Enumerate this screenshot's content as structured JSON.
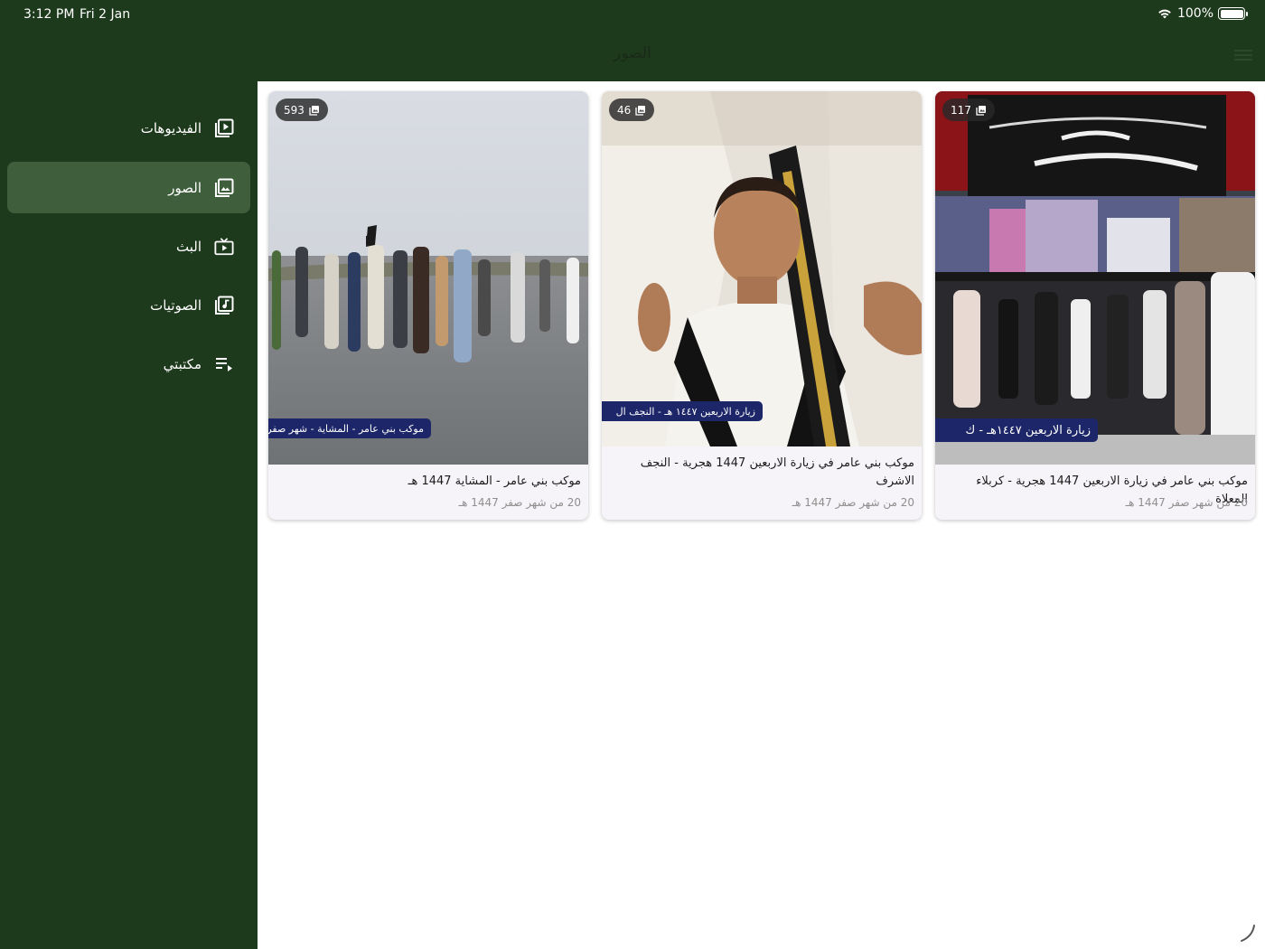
{
  "status_bar": {
    "time": "3:12 PM",
    "date": "Fri 2 Jan",
    "battery": "100%"
  },
  "nav": {
    "title": "الصور"
  },
  "sidebar": {
    "items": [
      {
        "label": "الفيديوهات",
        "icon": "video-library-icon",
        "active": false
      },
      {
        "label": "الصور",
        "icon": "photo-library-icon",
        "active": true
      },
      {
        "label": "البث",
        "icon": "live-tv-icon",
        "active": false
      },
      {
        "label": "الصوتيات",
        "icon": "audio-library-icon",
        "active": false
      },
      {
        "label": "مكتبتي",
        "icon": "playlist-icon",
        "active": false
      }
    ]
  },
  "albums": [
    {
      "count": "117",
      "banner_text": "زيارة الاربعين ١٤٤٧هـ - ك",
      "title": "موكب بني عامر في زيارة الاربعين 1447 هجرية - كربلاء المعلاة",
      "date": "20 من شهر صفر 1447 هـ"
    },
    {
      "count": "46",
      "banner_text": "زيارة الاربعين ١٤٤٧ هـ - النجف ال",
      "title": "موكب بني عامر في زيارة الاربعين 1447 هجرية - النجف الاشرف",
      "date": "20 من شهر صفر 1447 هـ"
    },
    {
      "count": "593",
      "banner_text": "موكب بني عامر - المشاية - شهر صفر",
      "title": "موكب بني عامر - المشاية 1447 هـ",
      "date": "20 من شهر صفر 1447 هـ"
    }
  ]
}
